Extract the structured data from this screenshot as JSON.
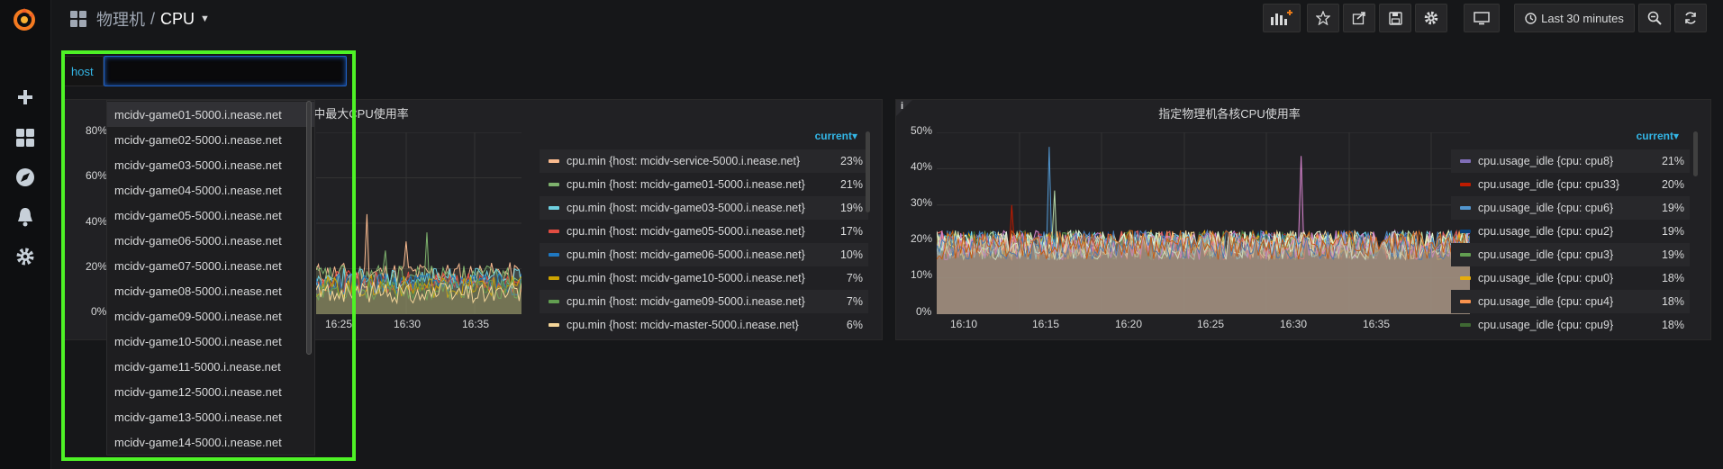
{
  "breadcrumb": {
    "folder": "物理机",
    "separator": "/",
    "title": "CPU"
  },
  "toolbar": {
    "time_range": "Last 30 minutes"
  },
  "variable": {
    "label": "host",
    "value": ""
  },
  "dropdown": {
    "options": [
      "mcidv-game01-5000.i.nease.net",
      "mcidv-game02-5000.i.nease.net",
      "mcidv-game03-5000.i.nease.net",
      "mcidv-game04-5000.i.nease.net",
      "mcidv-game05-5000.i.nease.net",
      "mcidv-game06-5000.i.nease.net",
      "mcidv-game07-5000.i.nease.net",
      "mcidv-game08-5000.i.nease.net",
      "mcidv-game09-5000.i.nease.net",
      "mcidv-game10-5000.i.nease.net",
      "mcidv-game11-5000.i.nease.net",
      "mcidv-game12-5000.i.nease.net",
      "mcidv-game13-5000.i.nease.net",
      "mcidv-game14-5000.i.nease.net"
    ]
  },
  "panel1": {
    "title": "各物理机的所有核中最大CPU使用率",
    "legend_header": "current",
    "y_ticks": [
      "80%",
      "60%",
      "40%",
      "20%",
      "0%"
    ],
    "x_ticks": [
      "16:25",
      "16:30",
      "16:35"
    ],
    "legend": [
      {
        "name": "cpu.min {host: mcidv-service-5000.i.nease.net}",
        "value": "23%",
        "color": "#f9ba8f"
      },
      {
        "name": "cpu.min {host: mcidv-game01-5000.i.nease.net}",
        "value": "21%",
        "color": "#7eb26d"
      },
      {
        "name": "cpu.min {host: mcidv-game03-5000.i.nease.net}",
        "value": "19%",
        "color": "#6ed0e0"
      },
      {
        "name": "cpu.min {host: mcidv-game05-5000.i.nease.net}",
        "value": "17%",
        "color": "#e24d42"
      },
      {
        "name": "cpu.min {host: mcidv-game06-5000.i.nease.net}",
        "value": "10%",
        "color": "#1f78c1"
      },
      {
        "name": "cpu.min {host: mcidv-game10-5000.i.nease.net}",
        "value": "7%",
        "color": "#cca300"
      },
      {
        "name": "cpu.min {host: mcidv-game09-5000.i.nease.net}",
        "value": "7%",
        "color": "#629e51"
      },
      {
        "name": "cpu.min {host: mcidv-master-5000.i.nease.net}",
        "value": "6%",
        "color": "#f4d598"
      }
    ]
  },
  "panel2": {
    "info": "i",
    "title": "指定物理机各核CPU使用率",
    "legend_header": "current",
    "y_ticks": [
      "50%",
      "40%",
      "30%",
      "20%",
      "10%",
      "0%"
    ],
    "x_ticks": [
      "16:10",
      "16:15",
      "16:20",
      "16:25",
      "16:30",
      "16:35"
    ],
    "legend": [
      {
        "name": "cpu.usage_idle {cpu: cpu8}",
        "value": "21%",
        "color": "#806eb7"
      },
      {
        "name": "cpu.usage_idle {cpu: cpu33}",
        "value": "20%",
        "color": "#bf1b00"
      },
      {
        "name": "cpu.usage_idle {cpu: cpu6}",
        "value": "19%",
        "color": "#5195ce"
      },
      {
        "name": "cpu.usage_idle {cpu: cpu2}",
        "value": "19%",
        "color": "#0a437c"
      },
      {
        "name": "cpu.usage_idle {cpu: cpu3}",
        "value": "19%",
        "color": "#629e51"
      },
      {
        "name": "cpu.usage_idle {cpu: cpu0}",
        "value": "18%",
        "color": "#e5ac0e"
      },
      {
        "name": "cpu.usage_idle {cpu: cpu4}",
        "value": "18%",
        "color": "#f9934e"
      },
      {
        "name": "cpu.usage_idle {cpu: cpu9}",
        "value": "18%",
        "color": "#3f6833"
      }
    ]
  }
}
